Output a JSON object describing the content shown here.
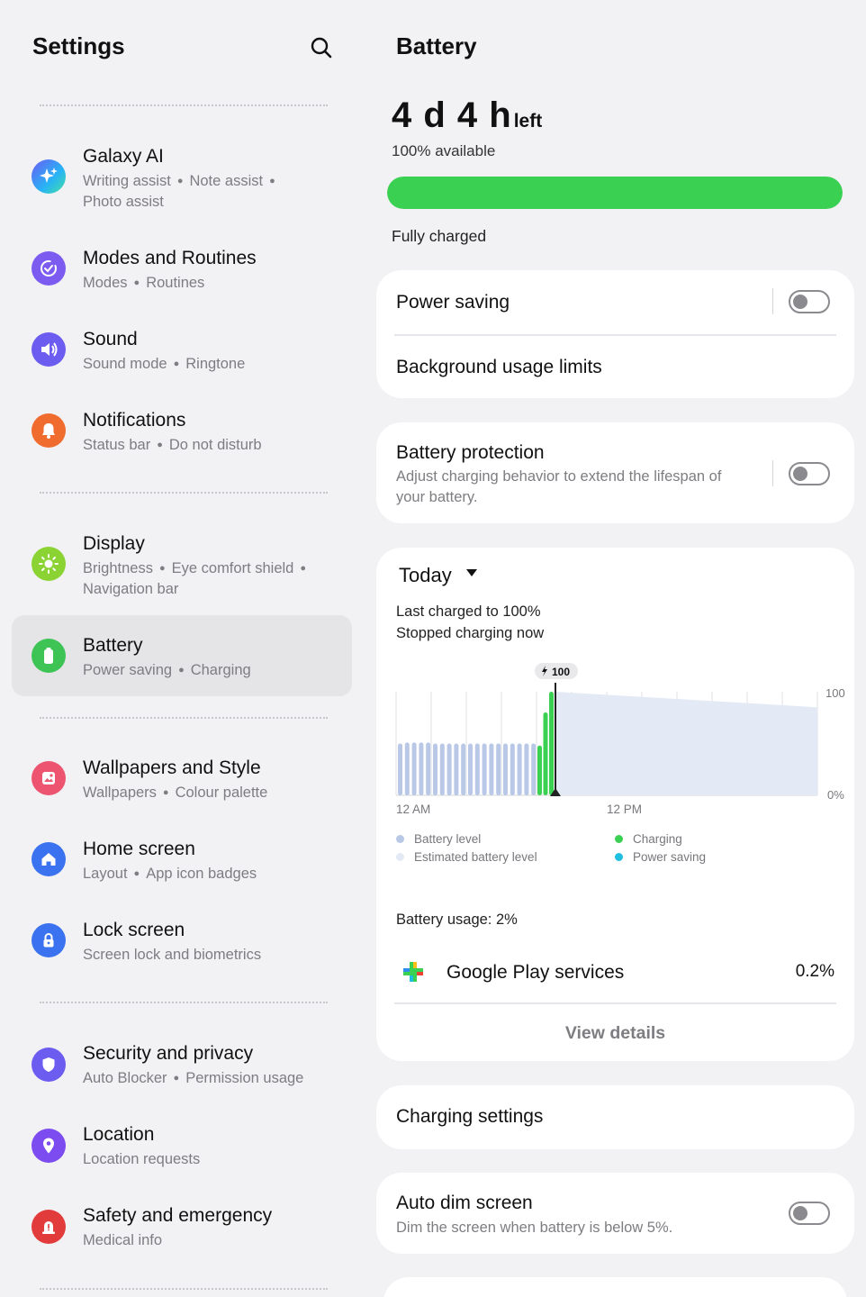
{
  "left": {
    "title": "Settings",
    "items": [
      {
        "title": "Galaxy AI",
        "subs": [
          "Writing assist",
          "Note assist",
          "Photo assist"
        ],
        "icon": "galaxy-ai-icon",
        "color": "#3a73f0"
      },
      {
        "title": "Modes and Routines",
        "subs": [
          "Modes",
          "Routines"
        ],
        "icon": "routines-icon",
        "color": "#7c5cf0"
      },
      {
        "title": "Sound",
        "subs": [
          "Sound mode",
          "Ringtone"
        ],
        "icon": "sound-icon",
        "color": "#6d5cf0"
      },
      {
        "title": "Notifications",
        "subs": [
          "Status bar",
          "Do not disturb"
        ],
        "icon": "bell-icon",
        "color": "#f06b2e"
      },
      {
        "title": "Display",
        "subs": [
          "Brightness",
          "Eye comfort shield",
          "Navigation bar"
        ],
        "icon": "sun-icon",
        "color": "#8ad333"
      },
      {
        "title": "Battery",
        "subs": [
          "Power saving",
          "Charging"
        ],
        "icon": "battery-icon",
        "color": "#3ec455"
      },
      {
        "title": "Wallpapers and Style",
        "subs": [
          "Wallpapers",
          "Colour palette"
        ],
        "icon": "wallpaper-icon",
        "color": "#ec5470"
      },
      {
        "title": "Home screen",
        "subs": [
          "Layout",
          "App icon badges"
        ],
        "icon": "home-icon",
        "color": "#3b72f0"
      },
      {
        "title": "Lock screen",
        "subs": [
          "Screen lock and biometrics"
        ],
        "icon": "lock-icon",
        "color": "#3b72f0"
      },
      {
        "title": "Security and privacy",
        "subs": [
          "Auto Blocker",
          "Permission usage"
        ],
        "icon": "shield-icon",
        "color": "#6d5cf0"
      },
      {
        "title": "Location",
        "subs": [
          "Location requests"
        ],
        "icon": "location-pin-icon",
        "color": "#7c4cf0"
      },
      {
        "title": "Safety and emergency",
        "subs": [
          "Medical info"
        ],
        "icon": "emergency-icon",
        "color": "#e23b3b"
      }
    ]
  },
  "right": {
    "title": "Battery",
    "time_big": "4 d 4 h",
    "time_small": "left",
    "available": "100% available",
    "level": 100,
    "status": "Fully charged",
    "power_saving": "Power saving",
    "background_limits": "Background usage limits",
    "protection_title": "Battery protection",
    "protection_sub": "Adjust charging behavior to extend the lifespan of your battery.",
    "today": "Today",
    "last_charged": "Last charged to 100%",
    "stopped": "Stopped charging now",
    "usage_label": "Battery usage: 2%",
    "app_name": "Google Play services",
    "app_pct": "0.2%",
    "view_details": "View details",
    "charging_settings": "Charging settings",
    "auto_dim_title": "Auto dim screen",
    "auto_dim_sub": "Dim the screen when battery is below 5%.",
    "legend": {
      "battery_level": "Battery level",
      "estimated": "Estimated battery level",
      "charging": "Charging",
      "power_saving": "Power saving"
    },
    "colors": {
      "battery_level": "#b8c8e6",
      "estimated": "#e3eaf6",
      "charging": "#3ad153",
      "power_saving": "#1fbfe0"
    }
  },
  "chart_data": {
    "type": "bar",
    "xlabels": [
      "12 AM",
      "12 PM"
    ],
    "ylabels": [
      "100",
      "0%"
    ],
    "ylim": [
      0,
      100
    ],
    "marker_label": "100",
    "battery_level": [
      50,
      51,
      51,
      51,
      51,
      50,
      50,
      50,
      50,
      50,
      50,
      50,
      50,
      50,
      50,
      50,
      50,
      50,
      50,
      50
    ],
    "charging": [
      48,
      80,
      100
    ],
    "estimated_start": 100,
    "estimated_end": 85
  }
}
